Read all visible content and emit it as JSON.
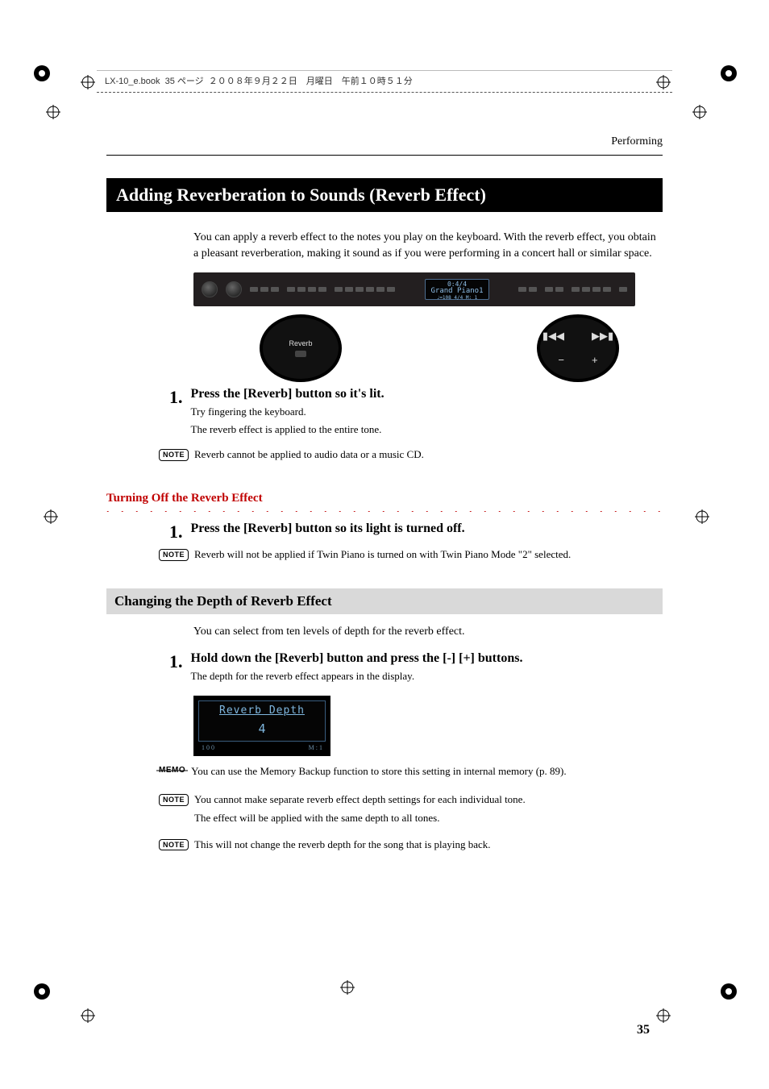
{
  "header": {
    "doc_info": "LX-10_e.book  35 ページ  ２００８年９月２２日　月曜日　午前１０時５１分"
  },
  "running_head": "Performing",
  "title_bar": "Adding Reverberation to Sounds (Reverb Effect)",
  "intro": "You can apply a reverb effect to the notes you play on the keyboard. With the reverb effect, you obtain a pleasant reverberation, making it sound as if you were performing in a concert hall or similar space.",
  "panel": {
    "lcd_line1": "0:4/4",
    "lcd_line2": "Grand Piano1",
    "lcd_line3": "♩=108    4/4  M:   1",
    "callout_left": "Reverb"
  },
  "section1": {
    "step1_num": "1.",
    "step1_title": "Press the [Reverb] button so it's lit.",
    "step1_l1": "Try fingering the keyboard.",
    "step1_l2": "The reverb effect is applied to the entire tone.",
    "note1_label": "NOTE",
    "note1_text": "Reverb cannot be applied to audio data or a music CD."
  },
  "section2": {
    "heading": "Turning Off the Reverb Effect",
    "step1_num": "1.",
    "step1_title": "Press the [Reverb] button so its light is turned off.",
    "note1_label": "NOTE",
    "note1_text": "Reverb will not be applied if Twin Piano is turned on with Twin Piano Mode \"2\" selected."
  },
  "section3": {
    "heading": "Changing the Depth of Reverb Effect",
    "intro": "You can select from ten levels of depth for the reverb effect.",
    "step1_num": "1.",
    "step1_title": "Hold down the [Reverb] button and press the [-] [+] buttons.",
    "step1_l1": "The depth for the reverb effect appears in the display.",
    "lcd_title": "Reverb Depth",
    "lcd_value": "4",
    "lcd_scale_left": "1 0 0",
    "lcd_scale_right": "M :     1",
    "memo_label": "MEMO",
    "memo_text": "You can use the Memory Backup function to store this setting in internal memory (p. 89).",
    "note1_label": "NOTE",
    "note1_l1": "You cannot make separate reverb effect depth settings for each individual tone.",
    "note1_l2": "The effect will be applied with the same depth to all tones.",
    "note2_label": "NOTE",
    "note2_text": "This will not change the reverb depth for the song that is playing back."
  },
  "page_num": "35"
}
